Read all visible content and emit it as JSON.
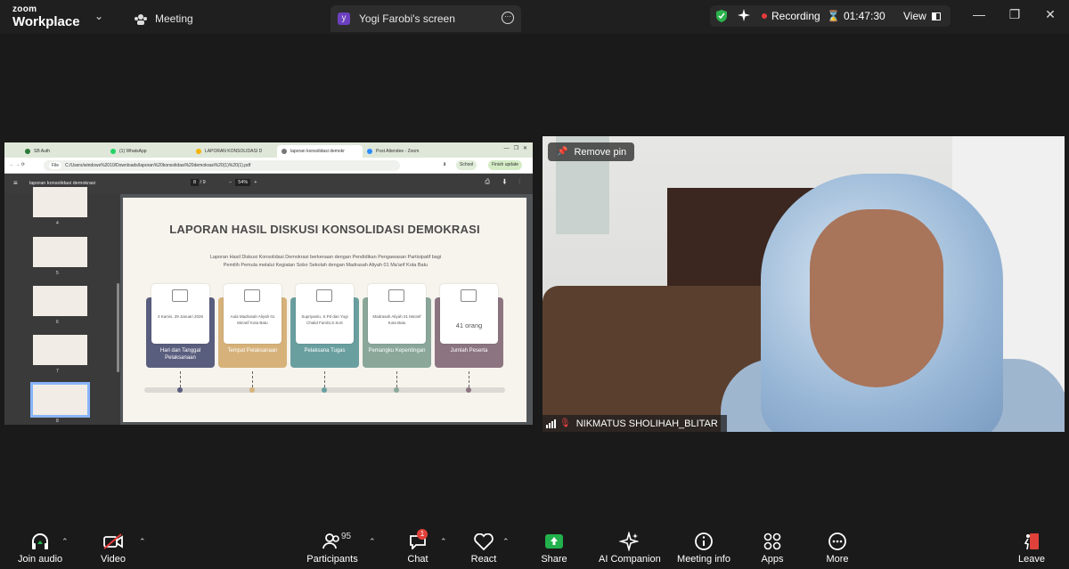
{
  "app": {
    "brand_line1": "zoom",
    "brand_line2": "Workplace"
  },
  "top_tabs": {
    "meeting": "Meeting",
    "share_badge": "y",
    "share": "Yogi Farobi's screen"
  },
  "status": {
    "recording": "Recording",
    "timer": "01:47:30",
    "view": "View"
  },
  "window_controls": {
    "minimize": "—",
    "restore": "❐",
    "close": "✕"
  },
  "shared_screen": {
    "browser_tabs": [
      "SB Auth",
      "(1) WhatsApp",
      "LAPORAN KONSOLIDASI D",
      "laporan konsolidasi demokr",
      "Post Attendee - Zoom"
    ],
    "url_file_label": "File",
    "url": "C:/Users/windows%2010/Downloads/laporan%20konsolidasi%20demokrasi%20(1)%20(1).pdf",
    "school_label": "School",
    "finish_update": "Finish update",
    "pdf_title": "laporan konsolidasi demokrasi",
    "page_current": "8",
    "page_sep": "/",
    "page_total": "9",
    "zoom": "54%",
    "zoom_minus": "−",
    "zoom_plus": "+",
    "thumb_numbers": [
      "4",
      "5",
      "6",
      "7",
      "8"
    ],
    "slide": {
      "title": "LAPORAN HASIL DISKUSI KONSOLIDASI DEMOKRASI",
      "subtitle": "Laporan Hasil Diskusi Konsolidasi Demokrasi berkenaan dengan Pendidikan Pengawasan Partisipatif bagi Pemilih Pemula melalui Kegiatan Sobo Sekolah dengan Madrasah Aliyah 01 Ma'arif Kota Batu",
      "cards": [
        {
          "text": "4 Kamis, 29 Januari 2026",
          "label": "Hari dan Tanggal Pelaksanaan",
          "color": "#5a5e7e"
        },
        {
          "text": "Aula Madrasah Aliyah 01 Ma'arif Kota Batu",
          "label": "Tempat Pelaksanaan",
          "color": "#d6b27a"
        },
        {
          "text": "Supriyanto, S.Pd dan Yogi Chalid Farobi,S.SoS",
          "label": "Pelaksana Tugas",
          "color": "#6a9fa0"
        },
        {
          "text": "Madrasah Aliyah 01 Ma'arif Kota Batu",
          "label": "Pemangku Kepentingan",
          "color": "#8aa79a"
        },
        {
          "text": "41 orang",
          "label": "Jumlah Peserta",
          "color": "#8c7580"
        }
      ]
    }
  },
  "video": {
    "remove_pin": "Remove pin",
    "participant_name": "NIKMATUS SHOLIHAH_BLITAR"
  },
  "toolbar": {
    "join_audio": "Join audio",
    "video": "Video",
    "participants": "Participants",
    "participants_count": "95",
    "chat": "Chat",
    "chat_badge": "1",
    "react": "React",
    "share": "Share",
    "ai_companion": "AI Companion",
    "meeting_info": "Meeting info",
    "apps": "Apps",
    "more": "More",
    "leave": "Leave"
  },
  "colors": {
    "share_green": "#22b14c",
    "record_red": "#e43b3b",
    "shield_green": "#2bb24c",
    "leave_red": "#e0413a"
  }
}
